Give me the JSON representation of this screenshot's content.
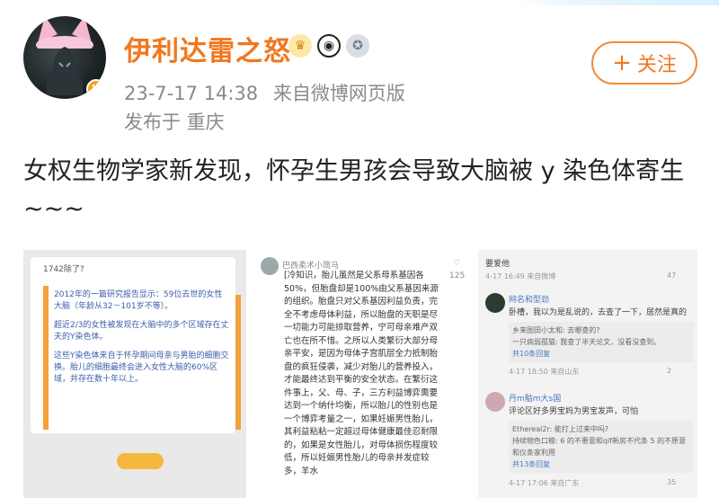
{
  "user": {
    "name": "伊利达雷之怒",
    "badges": [
      {
        "icon": "crown-badge-icon",
        "glyph": "♛"
      },
      {
        "icon": "panda-badge-icon",
        "glyph": "◉"
      },
      {
        "icon": "medal-badge-icon",
        "glyph": "✪"
      }
    ],
    "verified_glyph": "V"
  },
  "post_meta": {
    "timestamp": "23-7-17 14:38",
    "source": "来自微博网页版",
    "location": "发布于 重庆"
  },
  "follow_button": {
    "plus": "+",
    "label": "关注"
  },
  "post_text": "女权生物学家新发现，怀孕生男孩会导致大脑被 y 染色体寄生 ~~~",
  "images": {
    "img1": {
      "header": "1742除了?",
      "paragraphs": [
        "2012年的一篇研究报告显示：59位去世的女性大脑（年龄从32－101岁不等）。",
        "超近2/3的女性被发现在大脑中的多个区域存在丈夫的Y染色体。",
        "这些Y染色体来自于怀孕期间母亲与男胎的细胞交换。胎儿的细胞最终会进入女性大脑的60%区域，并存在数十年以上。"
      ]
    },
    "img2": {
      "username": "巴西柔术小简马",
      "side_count": "125",
      "body": "[冷知识，胎儿虽然是父系母系基因各50%，但胎盘却是100%由父系基因来源的组织。胎盘只对父系基因利益负责，完全不考虑母体利益，所以胎盘的天职是尽一切能力可能掠取营养，宁可母亲难产双亡也在所不惜。之所以人类繁衍大部分母亲平安，是因为母体子宫肌层全力抵制胎盘的疯狂侵袭，减少对胎儿的营养投入，才能最终达到平衡的安全状态。在繁衍这件事上，父、母、子，三方利益博弈需要达到一个纳什均衡，所以胎儿的性别也是一个博弈考量之一，如果妊娠男性胎儿，其利益粘粘一定超过母体健康最佳忍耐限的，如果是女性胎儿，对母体损伤程度较低，所以妊娠男性胎儿的母亲并发症较多，羊水"
    },
    "img3": {
      "top_line": "要爱他",
      "c1_meta": "4-17 16:49  来自微博",
      "c1_likes": "47",
      "c2_name": "网名和型劲",
      "c2_text": "卧槽，我以为是乱说的，去查了一下，居然是真的",
      "c2_sub1": "乡来图田小太和: 去哪查的?",
      "c2_sub2": "一只病弱孤猫: 我查了半天论文，没看没查到。",
      "c2_replies": "共10条回复",
      "c2_meta": "4-17 18:50  来自山东",
      "c2_likes": "2",
      "c3_name": "丹m骷m大s国",
      "c3_text": "评论区好多男宝妈为男宝发声，可怕",
      "c3_sub1": "Ethereal2r: 能打上过来中吗?",
      "c3_sub2": "持续物色口粮: 6 的不患意和qif新房不代条 5 的不原意和仪条家利用",
      "c3_replies": "共13条回复",
      "c3_meta": "4-17 17:06  来自广东",
      "c3_likes": "35"
    }
  },
  "colors": {
    "name_orange": "#f2771f",
    "meta_grey": "#8a8a8a",
    "follow_border": "#f28b3a",
    "img_accent": "#f2a13b",
    "text_blue": "#3b5ea8"
  }
}
